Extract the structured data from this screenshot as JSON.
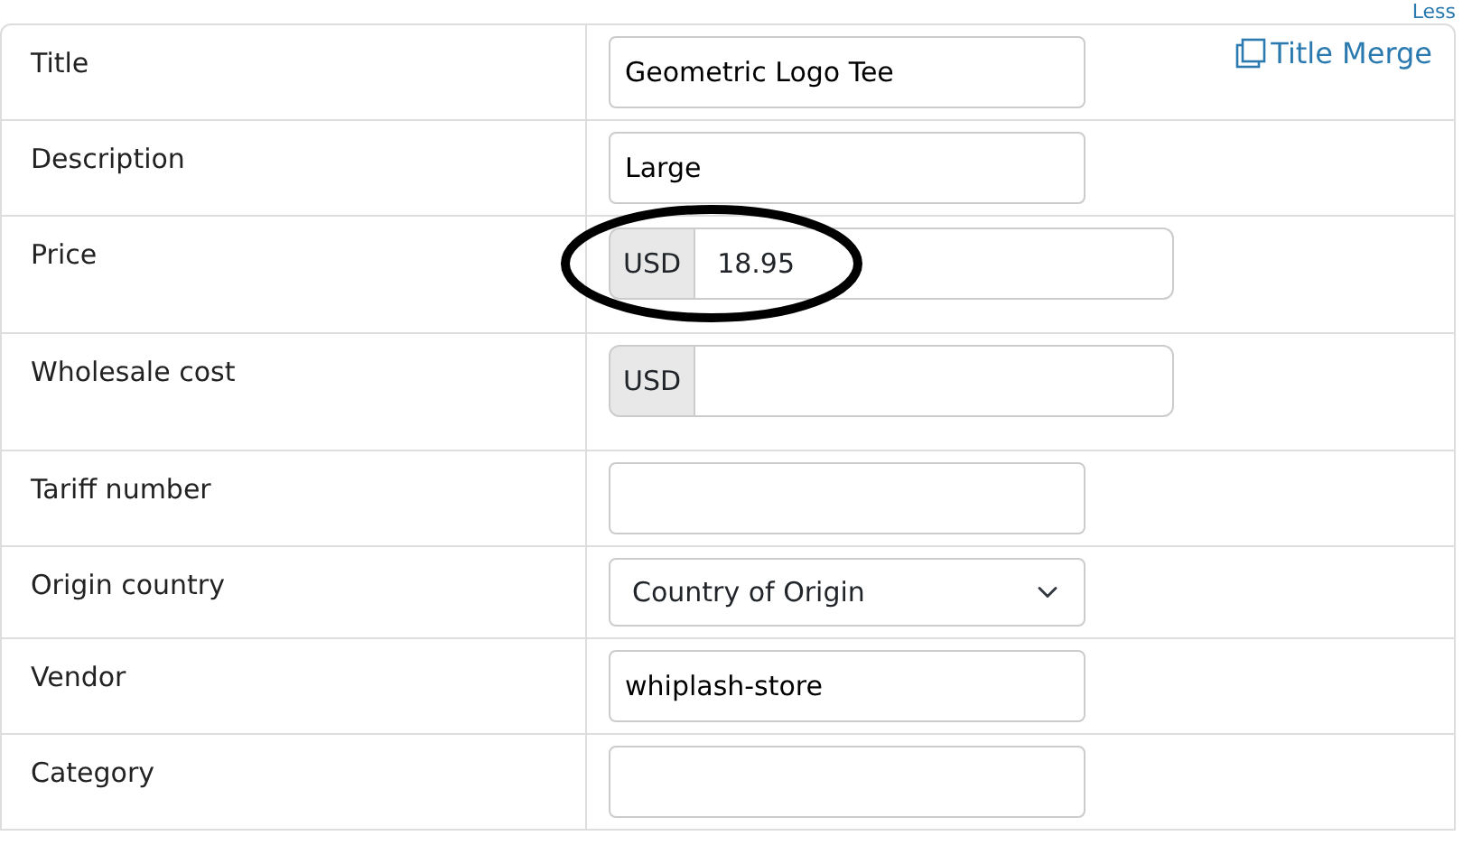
{
  "top_link": "Less",
  "title_merge": {
    "label": "Title Merge"
  },
  "fields": [
    {
      "label": "Title",
      "kind": "text",
      "value": "Geometric Logo Tee"
    },
    {
      "label": "Description",
      "kind": "text",
      "value": "Large"
    },
    {
      "label": "Price",
      "kind": "currency",
      "currency": "USD",
      "value": "18.95",
      "circled": true
    },
    {
      "label": "Wholesale cost",
      "kind": "currency",
      "currency": "USD"
    },
    {
      "label": "Tariff number",
      "kind": "text"
    },
    {
      "label": "Origin country",
      "kind": "select",
      "value": "Country of Origin"
    },
    {
      "label": "Vendor",
      "kind": "text",
      "value": "whiplash-store"
    },
    {
      "label": "Category",
      "kind": "text"
    }
  ]
}
